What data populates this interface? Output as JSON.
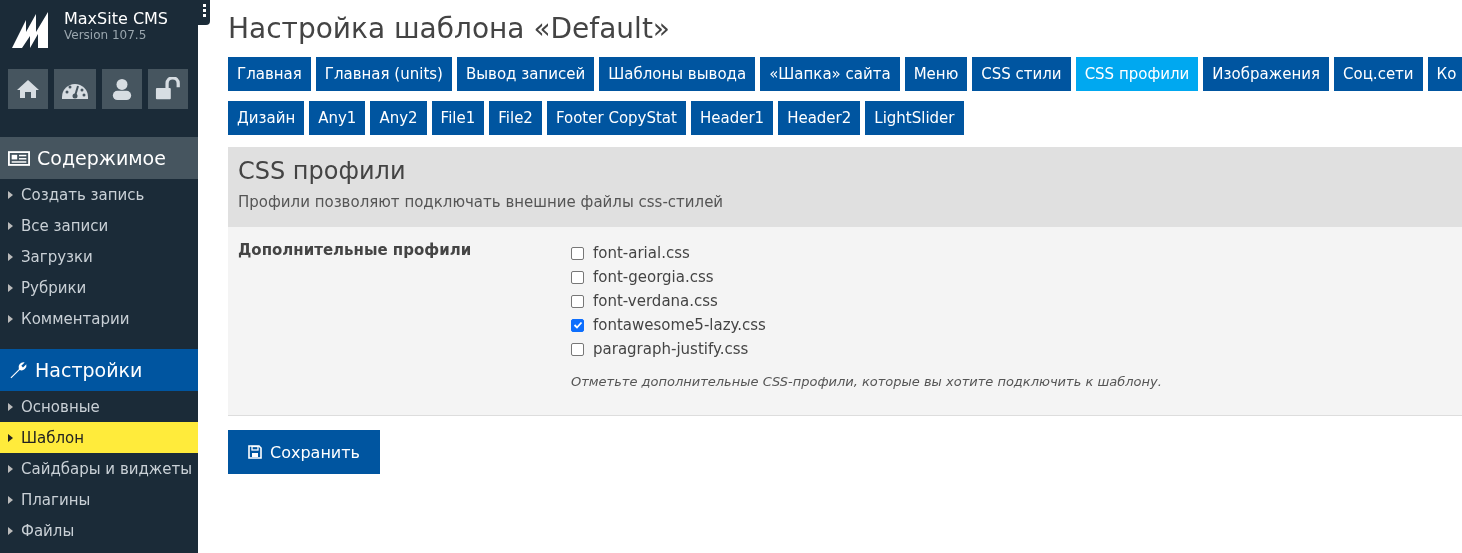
{
  "brand": {
    "name": "MaxSite CMS",
    "version": "Version 107.5"
  },
  "sidebar": {
    "sections": [
      {
        "title": "Содержимое",
        "kind": "content",
        "active": false,
        "items": [
          {
            "label": "Создать запись",
            "selected": false
          },
          {
            "label": "Все записи",
            "selected": false
          },
          {
            "label": "Загрузки",
            "selected": false
          },
          {
            "label": "Рубрики",
            "selected": false
          },
          {
            "label": "Комментарии",
            "selected": false
          }
        ]
      },
      {
        "title": "Настройки",
        "kind": "settings",
        "active": true,
        "items": [
          {
            "label": "Основные",
            "selected": false
          },
          {
            "label": "Шаблон",
            "selected": true
          },
          {
            "label": "Сайдбары и виджеты",
            "selected": false
          },
          {
            "label": "Плагины",
            "selected": false
          },
          {
            "label": "Файлы",
            "selected": false
          }
        ]
      }
    ]
  },
  "page_title": "Настройка шаблона «Default»",
  "tab_rows": [
    [
      {
        "label": "Главная",
        "selected": false
      },
      {
        "label": "Главная (units)",
        "selected": false
      },
      {
        "label": "Вывод записей",
        "selected": false
      },
      {
        "label": "Шаблоны вывода",
        "selected": false
      },
      {
        "label": "«Шапка» сайта",
        "selected": false
      },
      {
        "label": "Меню",
        "selected": false
      },
      {
        "label": "CSS стили",
        "selected": false
      },
      {
        "label": "CSS профили",
        "selected": true
      },
      {
        "label": "Изображения",
        "selected": false
      },
      {
        "label": "Соц.сети",
        "selected": false
      },
      {
        "label": "Ко",
        "selected": false
      }
    ],
    [
      {
        "label": "Дизайн",
        "selected": false
      },
      {
        "label": "Any1",
        "selected": false
      },
      {
        "label": "Any2",
        "selected": false
      },
      {
        "label": "File1",
        "selected": false
      },
      {
        "label": "File2",
        "selected": false
      },
      {
        "label": "Footer CopyStat",
        "selected": false
      },
      {
        "label": "Header1",
        "selected": false
      },
      {
        "label": "Header2",
        "selected": false
      },
      {
        "label": "LightSlider",
        "selected": false
      }
    ]
  ],
  "panel": {
    "title": "CSS профили",
    "description": "Профили позволяют подключать внешние файлы css-стилей",
    "field_label": "Дополнительные профили",
    "options": [
      {
        "label": "font-arial.css",
        "checked": false
      },
      {
        "label": "font-georgia.css",
        "checked": false
      },
      {
        "label": "font-verdana.css",
        "checked": false
      },
      {
        "label": "fontawesome5-lazy.css",
        "checked": true
      },
      {
        "label": "paragraph-justify.css",
        "checked": false
      }
    ],
    "hint": "Отметьте дополнительные CSS-профили, которые вы хотите подключить к шаблону."
  },
  "save_button": "Сохранить"
}
